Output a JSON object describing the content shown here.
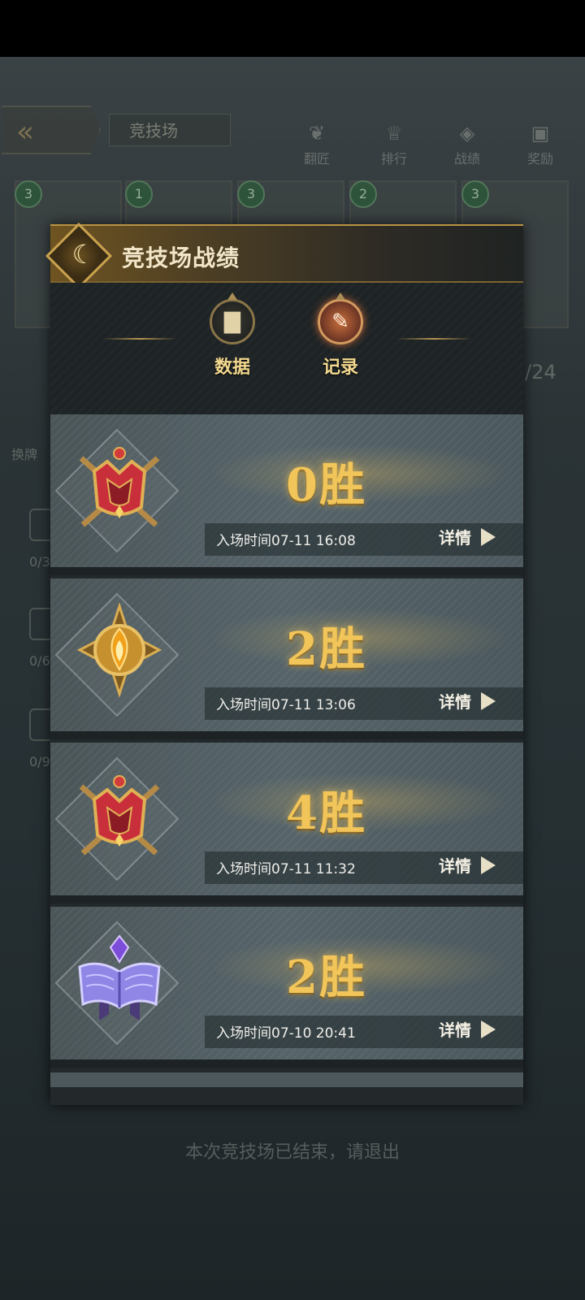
{
  "background": {
    "title": "竞技场",
    "nav": [
      {
        "label": "翻匠",
        "icon": "wing-icon"
      },
      {
        "label": "排行",
        "icon": "trophy-icon"
      },
      {
        "label": "战绩",
        "icon": "shield-icon"
      },
      {
        "label": "奖励",
        "icon": "reward-icon"
      }
    ],
    "card_levels": [
      "3",
      "1",
      "3",
      "2",
      "3"
    ],
    "side_text": "换牌",
    "side_counts": [
      "0/3",
      "0/6",
      "0/9"
    ],
    "right_counter": "/24",
    "bottom_notice": "本次竞技场已结束，请退出"
  },
  "modal": {
    "title": "竞技场战绩",
    "tabs": [
      {
        "label": "数据",
        "icon": "chart-icon",
        "active": false
      },
      {
        "label": "记录",
        "icon": "scroll-icon",
        "active": true
      }
    ],
    "records": [
      {
        "wins": "0胜",
        "time": "入场时间07-11 16:08",
        "detail": "详情",
        "badge": "crown-shield-badge-icon"
      },
      {
        "wins": "2胜",
        "time": "入场时间07-11 13:06",
        "detail": "详情",
        "badge": "sun-emblem-badge-icon"
      },
      {
        "wins": "4胜",
        "time": "入场时间07-11 11:32",
        "detail": "详情",
        "badge": "crown-shield-badge-icon"
      },
      {
        "wins": "2胜",
        "time": "入场时间07-10 20:41",
        "detail": "详情",
        "badge": "spellbook-badge-icon"
      }
    ]
  },
  "colors": {
    "gold": "#f1c559",
    "accent_orange": "#c86a38",
    "modal_bg": "#23292b"
  }
}
